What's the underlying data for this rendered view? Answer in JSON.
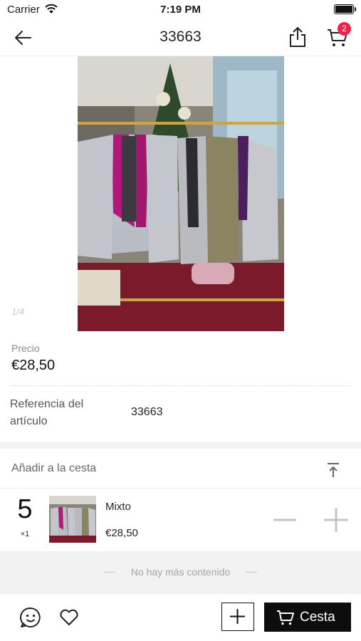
{
  "status_bar": {
    "carrier": "Carrier",
    "time": "7:19 PM"
  },
  "nav": {
    "title": "33663",
    "cart_badge": "2"
  },
  "product": {
    "image_pager": "1/4",
    "price_label": "Precio",
    "price_value": "€28,50",
    "reference_label": "Referencia del artículo",
    "reference_value": "33663"
  },
  "cart_section": {
    "header": "Añadir a la cesta",
    "item": {
      "quantity": "5",
      "quantity_multiplier": "×1",
      "variant": "Mixto",
      "price": "€28,50"
    }
  },
  "footer_note": "No hay más contenido",
  "bottom_bar": {
    "cesta_label": "Cesta"
  },
  "colors": {
    "badge": "#e8264a",
    "primary_button": "#0d0d0d",
    "separator_band": "#f2f2f2"
  }
}
